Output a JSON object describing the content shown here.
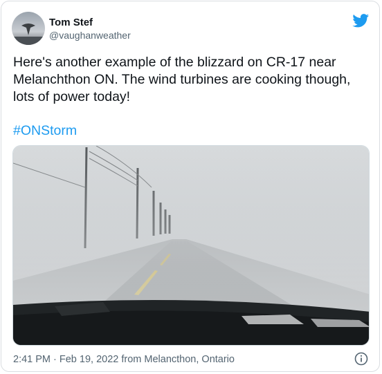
{
  "author": {
    "display_name": "Tom Stef",
    "handle": "@vaughanweather"
  },
  "tweet": {
    "text": "Here's another example of the blizzard on CR-17 near\nMelanchthon ON. The wind turbines are cooking though,\nlots of power today!",
    "hashtag": "#ONStorm"
  },
  "meta": {
    "timestamp": "2:41 PM · Feb 19, 2022 from Melancthon, Ontario"
  },
  "icons": {
    "brand": "twitter-bird-icon",
    "info": "info-icon"
  },
  "colors": {
    "brand": "#1d9bf0",
    "text": "#0f1419",
    "secondary": "#536471"
  }
}
